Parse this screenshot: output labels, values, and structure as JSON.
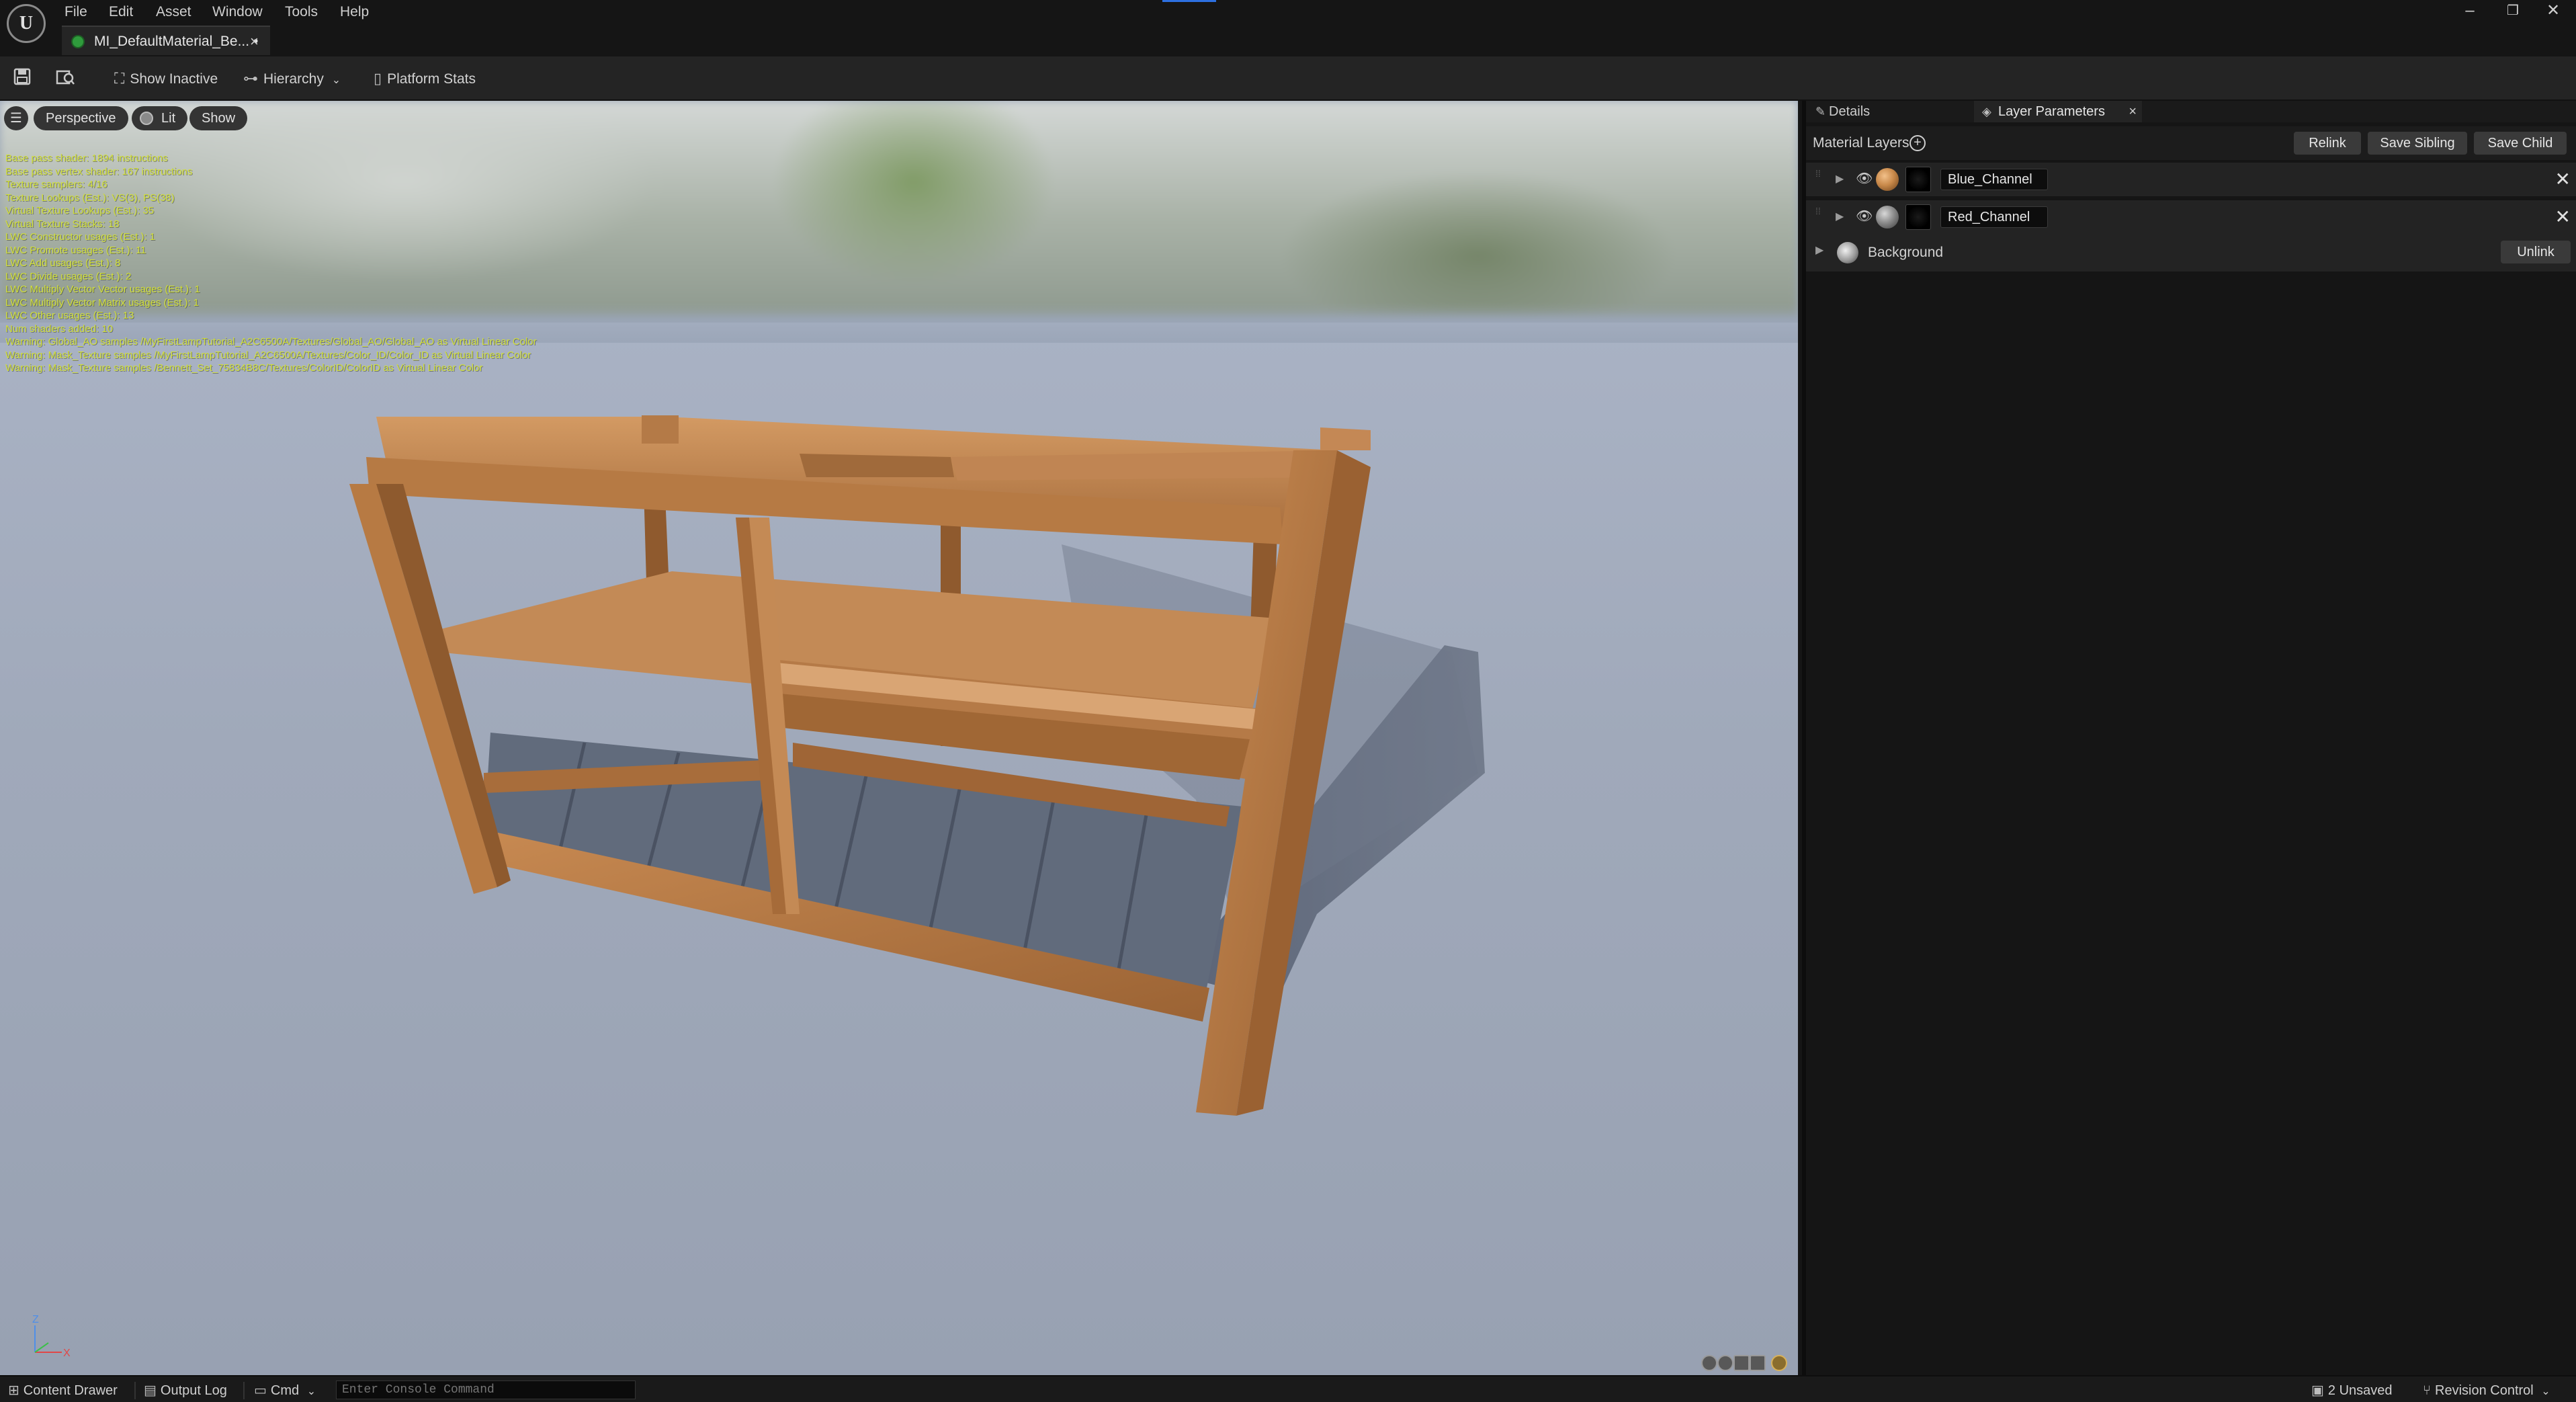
{
  "menu": [
    "File",
    "Edit",
    "Asset",
    "Window",
    "Tools",
    "Help"
  ],
  "document_tab": {
    "label": "MI_DefaultMaterial_Be...",
    "modified_mark": "•",
    "close": "×"
  },
  "window_controls": {
    "minimize": "–",
    "restore": "❐",
    "close": "✕"
  },
  "toolbar": {
    "show_inactive": "Show Inactive",
    "hierarchy": "Hierarchy",
    "platform_stats": "Platform Stats"
  },
  "viewport": {
    "view_mode": "Perspective",
    "lighting": "Lit",
    "show": "Show",
    "stats_lines": [
      "Base pass shader: 1894 instructions",
      "Base pass vertex shader: 167 instructions",
      "Texture samplers: 4/16",
      "Texture Lookups (Est.): VS(3), PS(38)",
      "Virtual Texture Lookups (Est.): 35",
      "Virtual Texture Stacks: 18",
      "LWC Constructor usages (Est.): 1",
      "LWC Promote usages (Est.): 11",
      "LWC Add usages (Est.): 8",
      "LWC Divide usages (Est.): 2",
      "LWC Multiply Vector Vector usages (Est.): 1",
      "LWC Multiply Vector Matrix usages (Est.): 1",
      "LWC Other usages (Est.): 13",
      "Num shaders added: 10",
      "Warning: Global_AO samples /MyFirstLampTutorial_A2C6500A/Textures/Global_AO/Global_AO as Virtual Linear Color",
      "Warning: Mask_Texture samples /MyFirstLampTutorial_A2C6500A/Textures/Color_ID/Color_ID as Virtual Linear Color",
      "Warning: Mask_Texture samples /Bennett_Set_75834B8C/Textures/ColorID/ColorID as Virtual Linear Color"
    ],
    "axis_labels": {
      "x": "X",
      "z": "Z"
    }
  },
  "panel": {
    "tabs": {
      "details": "Details",
      "layer_parameters": "Layer Parameters",
      "close": "×"
    },
    "material_layers_title": "Material Layers",
    "buttons": {
      "relink": "Relink",
      "save_sibling": "Save Sibling",
      "save_child": "Save Child",
      "unlink": "Unlink"
    },
    "layers": [
      {
        "name": "Blue_Channel",
        "thumb_color": "#c98a4b"
      },
      {
        "name": "Red_Channel",
        "thumb_color": "#8c8c8c"
      }
    ],
    "background_label": "Background"
  },
  "statusbar": {
    "content_drawer": "Content Drawer",
    "output_log": "Output Log",
    "cmd": "Cmd",
    "console_placeholder": "Enter Console Command",
    "unsaved": "2 Unsaved",
    "revision_control": "Revision Control"
  },
  "colors": {
    "accent_blue": "#2d6fe0",
    "stats_text": "#d2e03a",
    "wood": "#b97a45",
    "panel_bg": "#151515"
  }
}
